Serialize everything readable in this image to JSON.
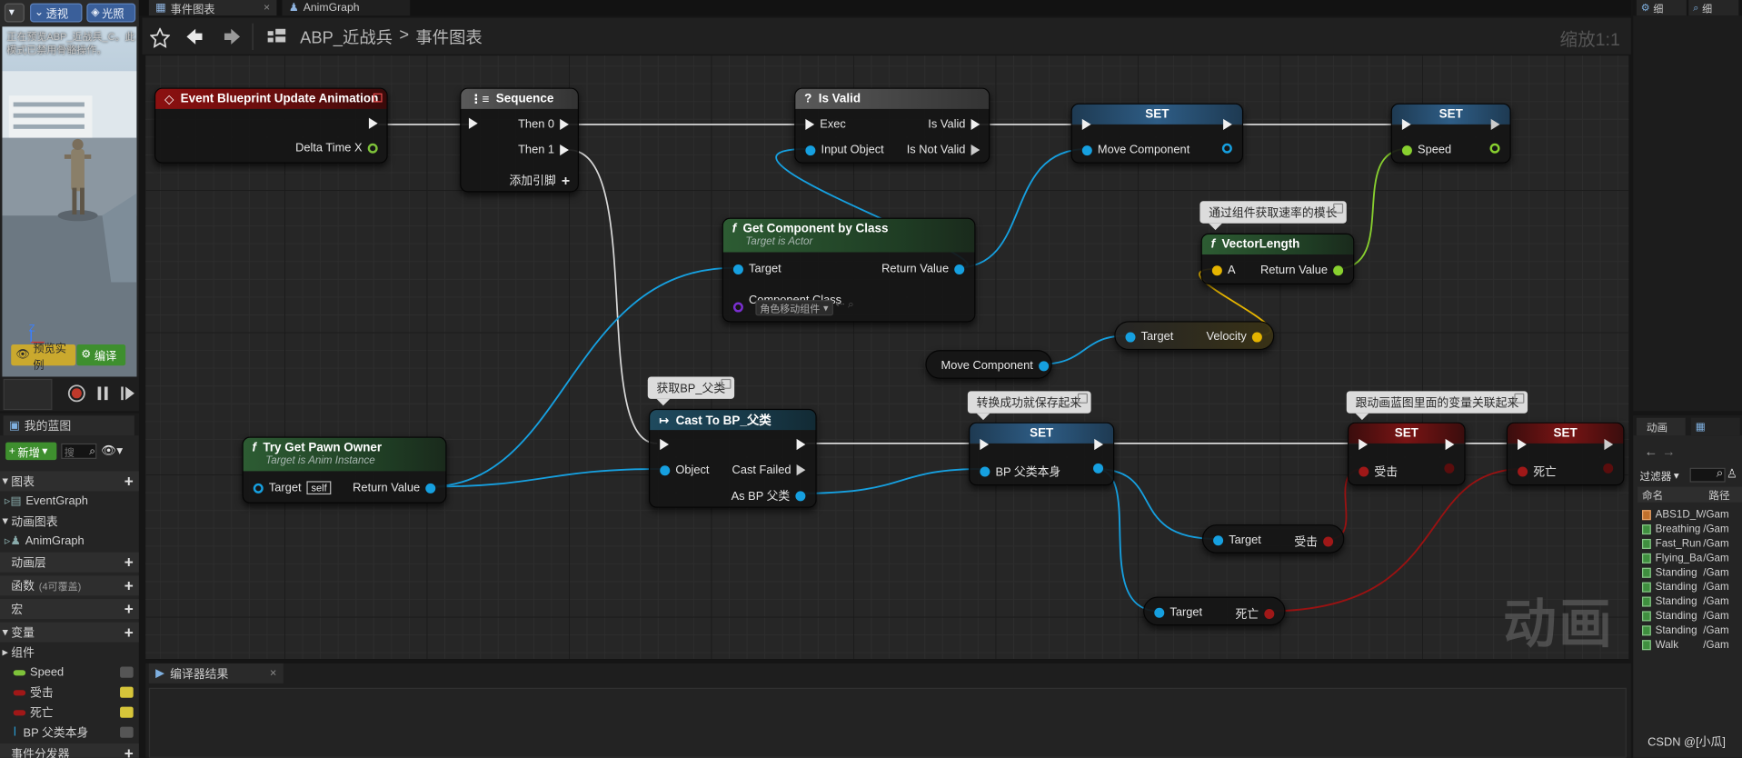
{
  "viewport": {
    "perspective_label": "透视",
    "lit_label": "光照",
    "notice": "正在预览ABP_近战兵_C。此模式已禁用骨骼操作。",
    "axis_label": "Z",
    "preview_instance_label": "预览实例",
    "compile_label": "编译"
  },
  "tabs": [
    {
      "label": "事件图表"
    },
    {
      "label": "AnimGraph"
    }
  ],
  "toolbar": {
    "breadcrumb_root": "ABP_近战兵",
    "breadcrumb_sep": ">",
    "breadcrumb_current": "事件图表",
    "zoom": "缩放1:1"
  },
  "mybp": {
    "title": "我的蓝图",
    "add_new": "新增",
    "search_placeholder": "搜",
    "graphs_label": "图表",
    "eventgraph": "EventGraph",
    "anim_graphs_label": "动画图表",
    "animgraph": "AnimGraph",
    "anim_layers": "动画层",
    "functions": "函数",
    "functions_sub": "(4可覆盖)",
    "macros": "宏",
    "variables": "变量",
    "components": "组件",
    "vars": [
      {
        "name": "Speed",
        "color": "#7ec23a"
      },
      {
        "name": "受击",
        "color": "#a01818"
      },
      {
        "name": "死亡",
        "color": "#a01818"
      },
      {
        "name": "BP 父类本身",
        "color": "#2a9fd6"
      }
    ],
    "event_dispatchers": "事件分发器"
  },
  "graph": {
    "watermark": "动画",
    "nodes": {
      "event_update": {
        "title": "Event Blueprint Update Animation",
        "delta": "Delta Time X"
      },
      "sequence": {
        "title": "Sequence",
        "then0": "Then 0",
        "then1": "Then 1",
        "add_pin": "添加引脚"
      },
      "is_valid": {
        "title": "Is Valid",
        "exec": "Exec",
        "input": "Input Object",
        "is_valid": "Is Valid",
        "is_not_valid": "Is Not Valid"
      },
      "set_move": {
        "title": "SET",
        "pin": "Move Component"
      },
      "set_speed": {
        "title": "SET",
        "pin": "Speed"
      },
      "get_component": {
        "title": "Get Component by Class",
        "subtitle": "Target is Actor",
        "target": "Target",
        "ret": "Return Value",
        "comp_class": "Component Class",
        "comp_value": "角色移动组件"
      },
      "vector_length": {
        "title": "VectorLength",
        "a": "A",
        "ret": "Return Value"
      },
      "velocity": {
        "target": "Target",
        "velocity": "Velocity"
      },
      "move_comp_get": {
        "label": "Move Component"
      },
      "try_get_pawn": {
        "title": "Try Get Pawn Owner",
        "subtitle": "Target is Anim Instance",
        "target": "Target",
        "self": "self",
        "ret": "Return Value"
      },
      "cast": {
        "title": "Cast To BP_父类",
        "object": "Object",
        "cast_failed": "Cast Failed",
        "as_bp": "As BP 父类"
      },
      "set_bp": {
        "title": "SET",
        "pin": "BP 父类本身"
      },
      "set_hit": {
        "title": "SET",
        "pin": "受击"
      },
      "set_dead": {
        "title": "SET",
        "pin": "死亡"
      },
      "get_hit": {
        "target": "Target",
        "var": "受击"
      },
      "get_dead": {
        "target": "Target",
        "var": "死亡"
      }
    },
    "comments": {
      "vector": "通过组件获取速率的模长",
      "cast": "获取BP_父类",
      "save": "转换成功就保存起来",
      "link": "跟动画蓝图里面的变量关联起来"
    }
  },
  "compiler": {
    "tab": "编译器结果"
  },
  "right": {
    "tab1": "细",
    "tab2": "细",
    "anim_tab": "动画",
    "filter": "过滤器",
    "col_name": "命名",
    "col_path": "路径",
    "assets": [
      {
        "name": "ABS1D_Mo",
        "path": "/Gam"
      },
      {
        "name": "Breathing",
        "path": "/Gam"
      },
      {
        "name": "Fast_Run",
        "path": "/Gam"
      },
      {
        "name": "Flying_Ba",
        "path": "/Gam"
      },
      {
        "name": "Standing",
        "path": "/Gam"
      },
      {
        "name": "Standing",
        "path": "/Gam"
      },
      {
        "name": "Standing",
        "path": "/Gam"
      },
      {
        "name": "Standing",
        "path": "/Gam"
      },
      {
        "name": "Standing",
        "path": "/Gam"
      },
      {
        "name": "Walk",
        "path": "/Gam"
      }
    ]
  },
  "watermark_csdn": "CSDN @[小瓜]"
}
